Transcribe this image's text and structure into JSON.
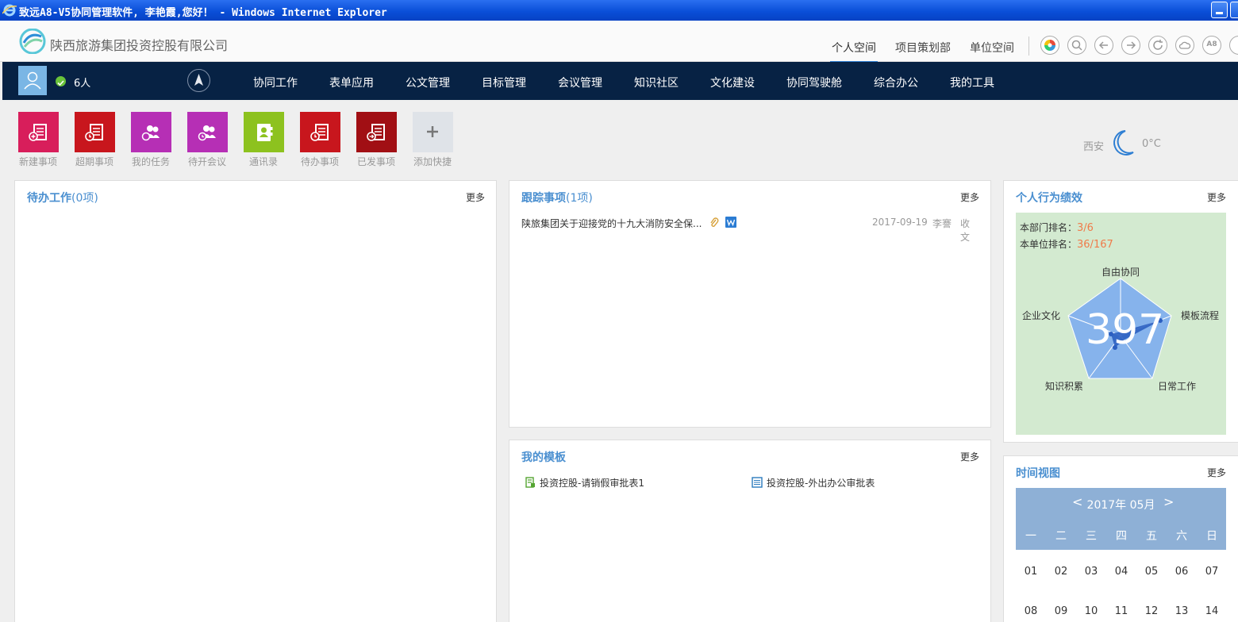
{
  "window": {
    "title": "致远A8-V5协同管理软件, 李艳霞,您好！ - Windows Internet Explorer"
  },
  "header": {
    "company": "陕西旅游集团投资控股有限公司",
    "space_tabs": [
      "个人空间",
      "项目策划部",
      "单位空间"
    ],
    "tool_icons": [
      "color-wheel-icon",
      "search-icon",
      "back-icon",
      "forward-icon",
      "refresh-icon",
      "cloud-icon",
      "a8-icon"
    ],
    "a8_label": "A8"
  },
  "nav": {
    "online_count": "6人",
    "items": [
      "协同工作",
      "表单应用",
      "公文管理",
      "目标管理",
      "会议管理",
      "知识社区",
      "文化建设",
      "协同驾驶舱",
      "综合办公",
      "我的工具"
    ]
  },
  "shortcuts": [
    {
      "label": "新建事项",
      "color": "#d81e5b",
      "icon": "new-item-icon"
    },
    {
      "label": "超期事项",
      "color": "#c8161d",
      "icon": "overdue-icon"
    },
    {
      "label": "我的任务",
      "color": "#b62fb5",
      "icon": "task-icon"
    },
    {
      "label": "待开会议",
      "color": "#b62fb5",
      "icon": "meeting-icon"
    },
    {
      "label": "通讯录",
      "color": "#8dc21f",
      "icon": "contacts-icon"
    },
    {
      "label": "待办事项",
      "color": "#c8161d",
      "icon": "todo-icon"
    },
    {
      "label": "已发事项",
      "color": "#a10f14",
      "icon": "sent-icon"
    },
    {
      "label": "添加快捷",
      "color": "#dfe3e8",
      "icon": "plus-icon"
    }
  ],
  "weather": {
    "city": "西安",
    "temp": "0°C"
  },
  "pending": {
    "title": "待办工作",
    "count": "(0项)",
    "more": "更多"
  },
  "tracking": {
    "title": "跟踪事项",
    "count": "(1项)",
    "more": "更多",
    "rows": [
      {
        "title": "陕旅集团关于迎接党的十九大消防安全保...",
        "date": "2017-09-19",
        "user": "李謇",
        "type": "收文"
      }
    ]
  },
  "templates": {
    "title": "我的模板",
    "more": "更多",
    "items": [
      "投资控股-请销假审批表1",
      "投资控股-外出办公审批表"
    ]
  },
  "performance": {
    "title": "个人行为绩效",
    "more": "更多",
    "dept_rank_label": "本部门排名：",
    "dept_rank": "3/6",
    "unit_rank_label": "本单位排名：",
    "unit_rank": "36/167",
    "score": "397",
    "axes": [
      "自由协同",
      "模板流程",
      "日常工作",
      "知识积累",
      "企业文化"
    ]
  },
  "calendar": {
    "title": "时间视图",
    "more": "更多",
    "month": "2017年 05月",
    "prev": "<",
    "next": ">",
    "weekdays": [
      "一",
      "二",
      "三",
      "四",
      "五",
      "六",
      "日"
    ],
    "days": [
      [
        "01",
        "02",
        "03",
        "04",
        "05",
        "06",
        "07"
      ],
      [
        "08",
        "09",
        "10",
        "11",
        "12",
        "13",
        "14"
      ]
    ]
  }
}
